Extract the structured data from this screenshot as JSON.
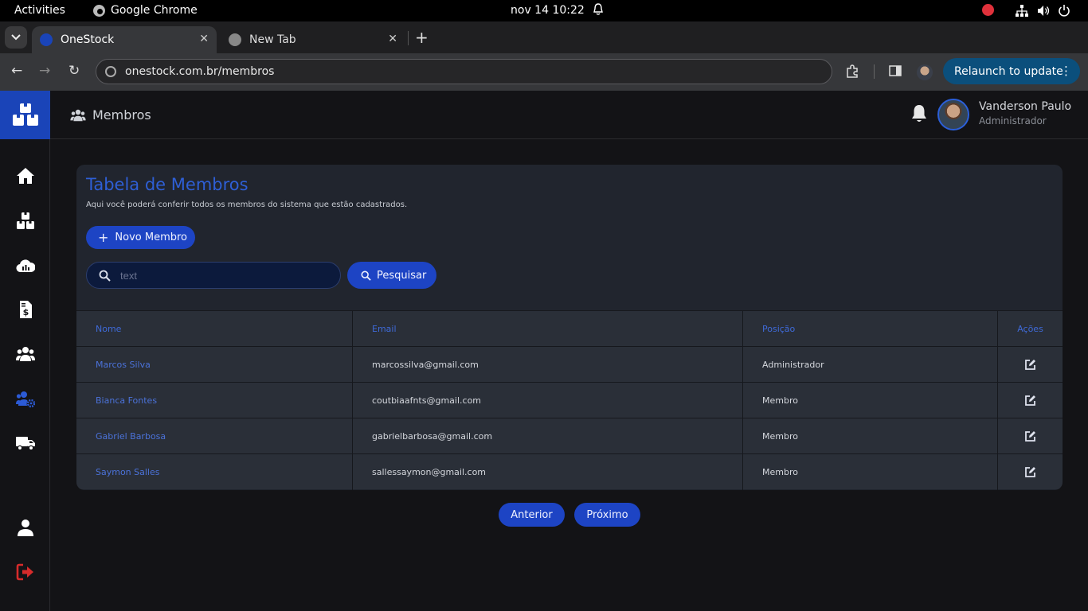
{
  "os_topbar": {
    "activities": "Activities",
    "app_name": "Google Chrome",
    "clock": "nov 14  10:22"
  },
  "browser": {
    "tabs": [
      {
        "title": "OneStock",
        "active": true
      },
      {
        "title": "New Tab",
        "active": false
      }
    ],
    "url": "onestock.com.br/membros",
    "relaunch_label": "Relaunch to update"
  },
  "header": {
    "page_title": "Membros",
    "user_name": "Vanderson Paulo",
    "user_role": "Administrador"
  },
  "sidebar": {
    "items": [
      {
        "icon": "home-icon",
        "active": false
      },
      {
        "icon": "boxes-icon",
        "active": false
      },
      {
        "icon": "cloud-chart-icon",
        "active": false
      },
      {
        "icon": "invoice-icon",
        "active": false
      },
      {
        "icon": "users-icon",
        "active": false
      },
      {
        "icon": "users-gear-icon",
        "active": true
      },
      {
        "icon": "truck-icon",
        "active": false
      },
      {
        "icon": "user-icon",
        "active": false
      },
      {
        "icon": "logout-icon",
        "active": false
      }
    ]
  },
  "card": {
    "title": "Tabela de Membros",
    "subtitle": "Aqui você poderá conferir todos os membros do sistema que estão cadastrados.",
    "new_button": "Novo Membro",
    "search_placeholder": "text",
    "search_button": "Pesquisar"
  },
  "table": {
    "columns": [
      "Nome",
      "Email",
      "Posição",
      "Ações"
    ],
    "rows": [
      {
        "name": "Marcos Silva",
        "email": "marcossilva@gmail.com",
        "position": "Administrador"
      },
      {
        "name": "Bianca Fontes",
        "email": "coutbiaafnts@gmail.com",
        "position": "Membro"
      },
      {
        "name": "Gabriel Barbosa",
        "email": "gabrielbarbosa@gmail.com",
        "position": "Membro"
      },
      {
        "name": "Saymon Salles",
        "email": "sallessaymon@gmail.com",
        "position": "Membro"
      }
    ]
  },
  "pagination": {
    "prev": "Anterior",
    "next": "Próximo"
  },
  "colors": {
    "accent": "#1d44c4",
    "logout": "#d62b2b"
  }
}
